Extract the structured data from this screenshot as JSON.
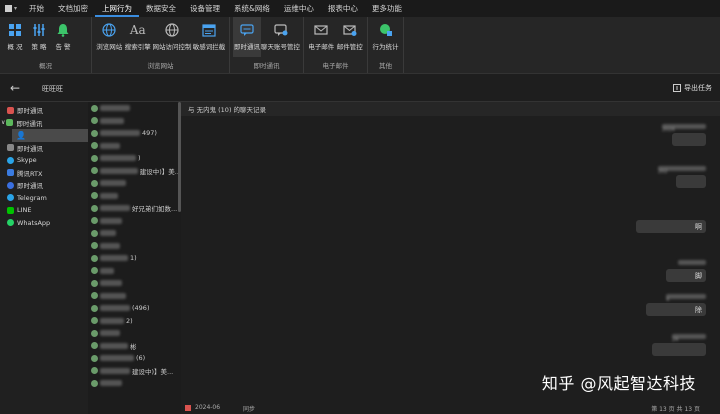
{
  "menubar": {
    "items": [
      "开始",
      "文档加密",
      "上网行为",
      "数据安全",
      "设备管理",
      "系统&网络",
      "运维中心",
      "报表中心",
      "更多功能"
    ],
    "active_index": 2
  },
  "ribbon": {
    "groups": [
      {
        "label": "概况",
        "tools": [
          {
            "label": "概 况",
            "icon": "dashboard-icon"
          },
          {
            "label": "策 略",
            "icon": "sliders-icon"
          },
          {
            "label": "告 警",
            "icon": "bell-icon"
          }
        ]
      },
      {
        "label": "浏览网站",
        "tools": [
          {
            "label": "浏览网站",
            "icon": "globe-icon"
          },
          {
            "label": "搜索引擎",
            "icon": "font-aa-icon"
          },
          {
            "label": "网站访问控制",
            "icon": "globe-lock-icon"
          },
          {
            "label": "敏感词拦截",
            "icon": "calendar-block-icon"
          }
        ]
      },
      {
        "label": "即时通讯",
        "tools": [
          {
            "label": "即时通讯",
            "icon": "chat-icon",
            "selected": true
          },
          {
            "label": "聊天账号管控",
            "icon": "chat-gear-icon"
          }
        ]
      },
      {
        "label": "电子邮件",
        "tools": [
          {
            "label": "电子邮件",
            "icon": "mail-icon"
          },
          {
            "label": "邮件管控",
            "icon": "mail-gear-icon"
          }
        ]
      },
      {
        "label": "其他",
        "tools": [
          {
            "label": "行为统计",
            "icon": "globe-chart-icon"
          }
        ]
      }
    ]
  },
  "topbar": {
    "title": "旺旺旺",
    "export": "导出任务"
  },
  "sidebar": {
    "items": [
      {
        "label": "即时通讯",
        "icon_color": "#d9534f",
        "level": 0
      },
      {
        "label": "即时通讯",
        "icon_color": "#5cb85c",
        "level": 0,
        "expanded": true
      },
      {
        "label": "",
        "icon_color": "#5b9bd5",
        "level": 1,
        "selected": true
      },
      {
        "label": "即时通讯",
        "icon_color": "#888888",
        "level": 0
      },
      {
        "label": "Skype",
        "icon_color": "#2aa4e8",
        "level": 0
      },
      {
        "label": "腾讯RTX",
        "icon_color": "#3a7be0",
        "level": 0
      },
      {
        "label": "即时通讯",
        "icon_color": "#3a6fe0",
        "level": 0
      },
      {
        "label": "Telegram",
        "icon_color": "#2aa4e8",
        "level": 0
      },
      {
        "label": "LINE",
        "icon_color": "#00c300",
        "level": 0
      },
      {
        "label": "WhatsApp",
        "icon_color": "#25d366",
        "level": 0
      }
    ]
  },
  "contacts": {
    "rows": [
      {
        "text": ""
      },
      {
        "text": ""
      },
      {
        "text": "497)"
      },
      {
        "text": ""
      },
      {
        "text": ")"
      },
      {
        "text": "建设中)】美..."
      },
      {
        "text": ""
      },
      {
        "text": ""
      },
      {
        "text": "好兄弟们如数..."
      },
      {
        "text": ""
      },
      {
        "text": ""
      },
      {
        "text": ""
      },
      {
        "text": "1)"
      },
      {
        "text": ""
      },
      {
        "text": ""
      },
      {
        "text": ""
      },
      {
        "text": "(496)"
      },
      {
        "text": "2)"
      },
      {
        "text": ""
      },
      {
        "text": "彬"
      },
      {
        "text": "(6)"
      },
      {
        "text": "建设中)】美..."
      },
      {
        "text": ""
      }
    ]
  },
  "chat": {
    "header": "与 无内鬼 (10) 的聊天记录",
    "messages": [
      {
        "ts": "2024",
        "text": ""
      },
      {
        "ts": "202",
        "text": ""
      },
      {
        "ts": "",
        "text": "啊"
      },
      {
        "ts": "",
        "text": "脚"
      },
      {
        "ts": "4",
        "text": "除"
      },
      {
        "ts": "24",
        "text": ""
      }
    ]
  },
  "footer": {
    "left": "2024-06",
    "mid": "同步",
    "right": "第 13 页  共 13 页"
  },
  "watermark": "知乎 @风起智达科技"
}
